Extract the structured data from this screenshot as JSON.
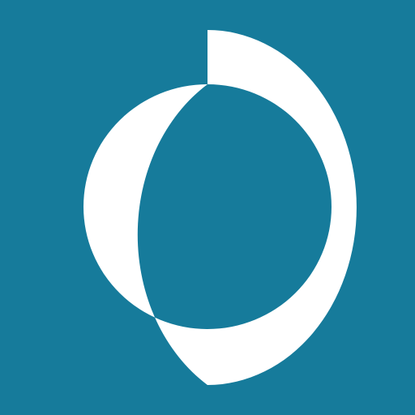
{
  "icon": {
    "name": "circular-logo-icon",
    "colors": {
      "background": "#167B9B",
      "mark": "#FFFFFF"
    }
  }
}
